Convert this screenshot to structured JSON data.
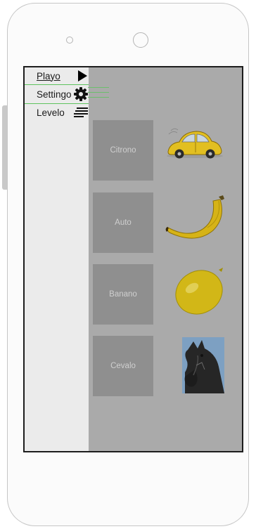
{
  "menu": {
    "items": [
      {
        "label": "Playo",
        "icon": "play-icon"
      },
      {
        "label": "Settingo",
        "icon": "gear-icon"
      },
      {
        "label": "Levelo",
        "icon": "menu-icon"
      }
    ]
  },
  "cards": [
    {
      "label": "Citrono",
      "image": "car-icon"
    },
    {
      "label": "Auto",
      "image": "banana-icon"
    },
    {
      "label": "Banano",
      "image": "lemon-icon"
    },
    {
      "label": "Cevalo",
      "image": "horse-icon"
    }
  ]
}
